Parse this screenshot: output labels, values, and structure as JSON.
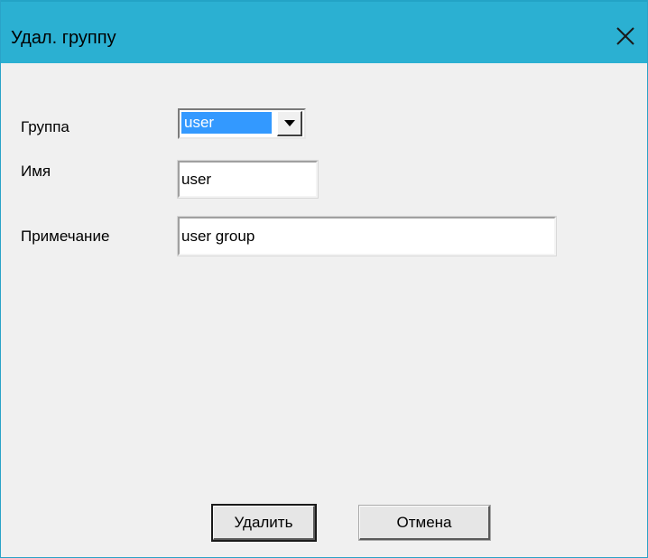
{
  "window": {
    "title": "Удал. группу",
    "close_icon": "close-icon"
  },
  "form": {
    "group": {
      "label": "Группа",
      "selected": "user"
    },
    "name": {
      "label": "Имя",
      "value": "user"
    },
    "note": {
      "label": "Примечание",
      "value": "user group"
    }
  },
  "buttons": {
    "delete_label": "Удалить",
    "cancel_label": "Отмена"
  },
  "colors": {
    "titlebar": "#2bb0d2",
    "selection": "#3399ff",
    "dialog_bg": "#f0f0f0"
  }
}
